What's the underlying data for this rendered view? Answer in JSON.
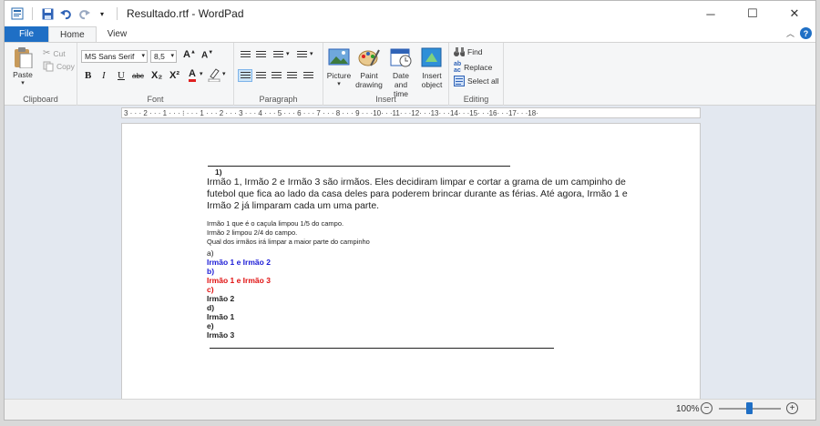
{
  "window": {
    "title": "Resultado.rtf - WordPad",
    "controls": {
      "minimize": "─",
      "maximize": "☐",
      "close": "✕"
    }
  },
  "tabs": [
    {
      "label": "File"
    },
    {
      "label": "Home"
    },
    {
      "label": "View"
    }
  ],
  "ribbon": {
    "clipboard": {
      "label": "Clipboard",
      "paste": "Paste",
      "cut": "Cut",
      "copy": "Copy"
    },
    "font": {
      "label": "Font",
      "family": "MS Sans Serif",
      "size": "8,5",
      "bold": "B",
      "italic": "I",
      "underline": "U",
      "strike": "abc",
      "subscript": "X₂",
      "superscript": "X²",
      "color": "A"
    },
    "paragraph": {
      "label": "Paragraph"
    },
    "insert": {
      "label": "Insert",
      "picture": "Picture",
      "paint_line1": "Paint",
      "paint_line2": "drawing",
      "datetime_line1": "Date and",
      "datetime_line2": "time",
      "object_line1": "Insert",
      "object_line2": "object"
    },
    "editing": {
      "label": "Editing",
      "find": "Find",
      "replace": "Replace",
      "select_all": "Select all"
    }
  },
  "ruler": {
    "text": "3 · · · 2 · · · 1 · · · ⁝ · · · 1 · · · 2 · · · 3 · · · 4 · · · 5 · · · 6 · · · 7 · · · 8 · · · 9 · · ·10· · ·11· · ·12· · ·13· · ·14· · ·15· · ·16· · ·17· · ·18·"
  },
  "document": {
    "question_number": "1)",
    "statement_lines": [
      "Irmão 1, Irmão 2 e Irmão 3 são irmãos. Eles decidiram limpar e cortar a grama de um campinho de",
      "futebol que fica ao lado da casa deles para poderem brincar durante as férias. Até agora, Irmão 1 e",
      "Irmão 2 já limparam cada um uma parte."
    ],
    "detail_lines": [
      "Irmão 1 que é o caçula limpou 1/5 do campo.",
      "Irmão 2  limpou 2/4 do campo.",
      "Qual dos irmãos irá limpar a maior parte do campinho"
    ],
    "options": [
      {
        "letter": " a)",
        "text": "Irmão 1 e Irmão 2",
        "color": "#1a1ad6"
      },
      {
        "letter": " b)",
        "text": "Irmão 1 e Irmão 3",
        "color": "#e01010"
      },
      {
        "letter": " c)",
        "text": "Irmão 2",
        "color": "#111111"
      },
      {
        "letter": " d)",
        "text": "Irmão 1",
        "color": "#111111"
      },
      {
        "letter": " e)",
        "text": "Irmão 3",
        "color": "#111111"
      }
    ]
  },
  "statusbar": {
    "zoom": "100%",
    "zoom_level_percent": 100,
    "minus": "−",
    "plus": "+"
  },
  "colors": {
    "accent": "#1f6fc5"
  }
}
